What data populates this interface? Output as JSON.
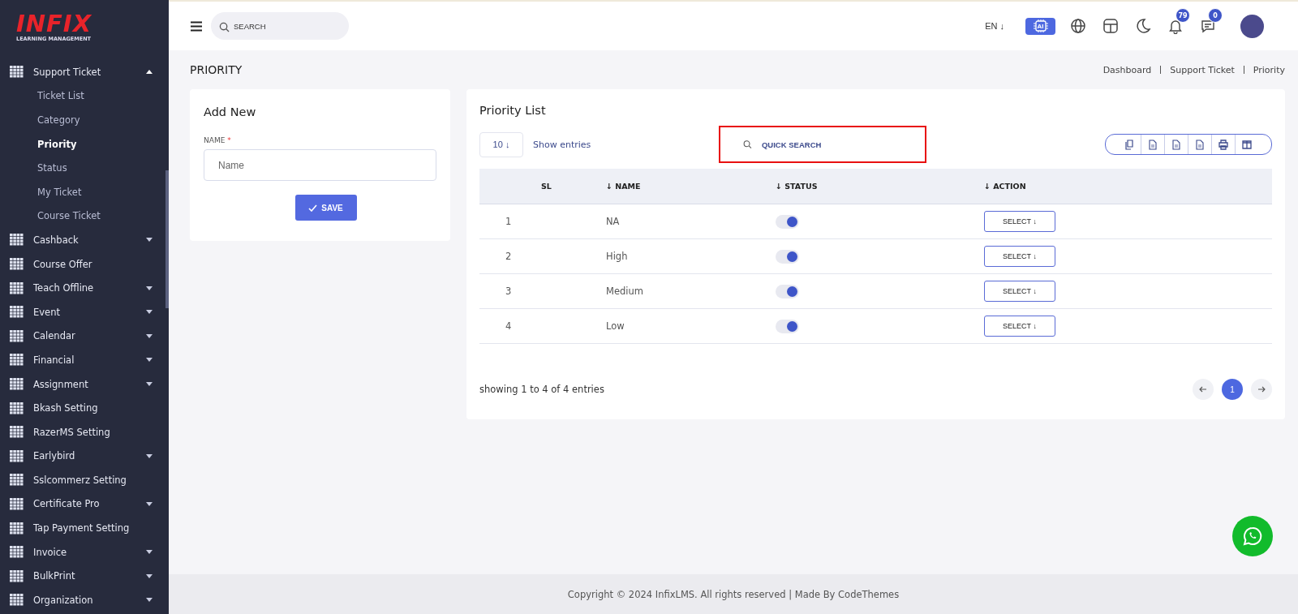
{
  "logo": {
    "name": "INFIX",
    "tagline": "LEARNING MANAGEMENT"
  },
  "sidebar": {
    "items": [
      {
        "label": "Support Ticket",
        "kind": "group",
        "expanded": true,
        "children": [
          {
            "label": "Ticket List",
            "selected": false
          },
          {
            "label": "Category",
            "selected": false
          },
          {
            "label": "Priority",
            "selected": true
          },
          {
            "label": "Status",
            "selected": false
          },
          {
            "label": "My Ticket",
            "selected": false
          },
          {
            "label": "Course Ticket",
            "selected": false
          }
        ]
      },
      {
        "label": "Cashback",
        "kind": "group",
        "expanded": false
      },
      {
        "label": "Course Offer",
        "kind": "link"
      },
      {
        "label": "Teach Offline",
        "kind": "group",
        "expanded": false
      },
      {
        "label": "Event",
        "kind": "group",
        "expanded": false
      },
      {
        "label": "Calendar",
        "kind": "group",
        "expanded": false
      },
      {
        "label": "Financial",
        "kind": "group",
        "expanded": false
      },
      {
        "label": "Assignment",
        "kind": "group",
        "expanded": false
      },
      {
        "label": "Bkash Setting",
        "kind": "link"
      },
      {
        "label": "RazerMS Setting",
        "kind": "link"
      },
      {
        "label": "Earlybird",
        "kind": "group",
        "expanded": false
      },
      {
        "label": "Sslcommerz Setting",
        "kind": "link"
      },
      {
        "label": "Certificate Pro",
        "kind": "group",
        "expanded": false
      },
      {
        "label": "Tap Payment Setting",
        "kind": "link"
      },
      {
        "label": "Invoice",
        "kind": "group",
        "expanded": false
      },
      {
        "label": "BulkPrint",
        "kind": "group",
        "expanded": false
      },
      {
        "label": "Organization",
        "kind": "group",
        "expanded": false
      }
    ]
  },
  "topbar": {
    "search": {
      "placeholder": "SEARCH"
    },
    "language": "EN ↓",
    "ai_label": "AI",
    "notifications": "79",
    "messages": "0"
  },
  "page": {
    "title": "PRIORITY",
    "breadcrumb": [
      "Dashboard",
      "Support Ticket",
      "Priority"
    ]
  },
  "add_form": {
    "title": "Add New",
    "field_label": "NAME",
    "required_mark": "*",
    "placeholder": "Name",
    "save": "SAVE"
  },
  "list": {
    "title": "Priority List",
    "page_size": "10 ↓",
    "show_entries": "Show entries",
    "search": {
      "placeholder": "QUICK SEARCH"
    },
    "columns": [
      "SL",
      "↓ NAME",
      "↓ STATUS",
      "↓ ACTION"
    ],
    "rows": [
      {
        "sl": "1",
        "name": "NA",
        "on": true,
        "action": "SELECT ↓"
      },
      {
        "sl": "2",
        "name": "High",
        "on": true,
        "action": "SELECT ↓"
      },
      {
        "sl": "3",
        "name": "Medium",
        "on": true,
        "action": "SELECT ↓"
      },
      {
        "sl": "4",
        "name": "Low",
        "on": true,
        "action": "SELECT ↓"
      }
    ],
    "summary": "showing 1 to 4 of 4 entries",
    "pages": [
      {
        "label": "1",
        "selected": true
      }
    ]
  },
  "footer": "Copyright © 2024 InfixLMS. All rights reserved | Made By CodeThemes"
}
